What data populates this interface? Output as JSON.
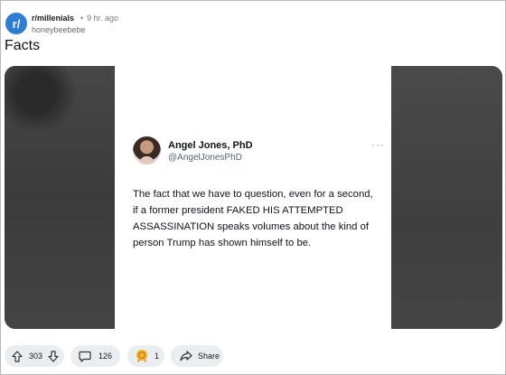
{
  "post": {
    "subreddit": "r/millenials",
    "subreddit_icon_glyph": "r/",
    "separator": "•",
    "time": "9 hr. ago",
    "author": "honeybeebebe",
    "title": "Facts"
  },
  "tweet": {
    "name": "Angel Jones, PhD",
    "handle": "@AngelJonesPhD",
    "more": "···",
    "text": "The fact that we have to question, even for a second, if a former president FAKED HIS ATTEMPTED ASSASSINATION speaks volumes about the kind of person Trump has shown himself to be."
  },
  "actions": {
    "upvotes": "303",
    "comments": "126",
    "awards": "1",
    "share_label": "Share"
  },
  "icons": {
    "upvote": "arrow-up-icon",
    "downvote": "arrow-down-icon",
    "comment": "comment-bubble-icon",
    "award": "award-icon",
    "share": "share-arrow-icon"
  },
  "colors": {
    "subreddit_icon": "#2f7dd1",
    "pill_background": "#ebeef0",
    "award": "#f0b52a"
  }
}
